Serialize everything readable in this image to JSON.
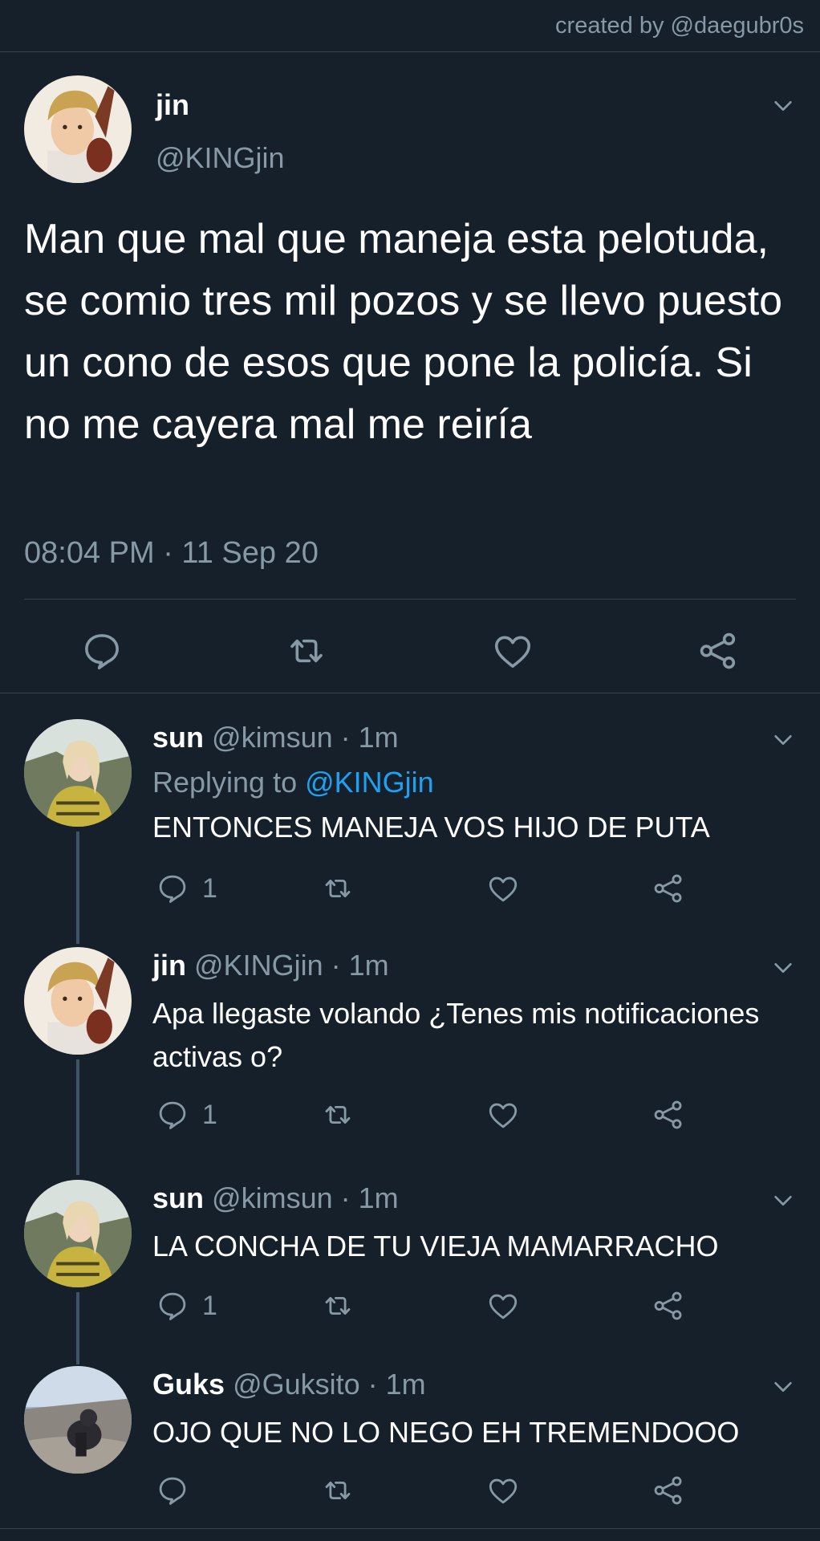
{
  "credit": "created by @daegubr0s",
  "main_tweet": {
    "name": "jin",
    "handle": "@KINGjin",
    "text": "Man que mal que maneja esta pelotuda, se comio tres mil pozos y se llevo puesto un cono de esos que pone la policía. Si no me cayera mal me reiría",
    "timestamp": "08:04 PM · 11 Sep 20",
    "icons": [
      "comment-icon",
      "retweet-icon",
      "like-icon",
      "share-icon"
    ]
  },
  "replies": [
    {
      "name": "sun",
      "handle": "@kimsun",
      "time": "· 1m",
      "replying_label": "Replying to",
      "replying_mention": "@KINGjin",
      "text": "ENTONCES MANEJA VOS HIJO DE PUTA",
      "reply_count": "1"
    },
    {
      "name": "jin",
      "handle": "@KINGjin",
      "time": "· 1m",
      "text": "Apa llegaste volando ¿Tenes mis notificaciones activas o?",
      "reply_count": "1"
    },
    {
      "name": "sun",
      "handle": "@kimsun",
      "time": "· 1m",
      "text": "LA CONCHA DE TU VIEJA MAMARRACHO",
      "reply_count": "1"
    },
    {
      "name": "Guks",
      "handle": "@Guksito",
      "time": "· 1m",
      "text": "OJO QUE NO LO NEGO EH TREMENDOOO",
      "reply_count": ""
    }
  ],
  "colors": {
    "background": "#15202b",
    "secondary_text": "#8899a6",
    "link": "#1da1f2",
    "divider": "#38444d",
    "thread_line": "#3d5466"
  }
}
